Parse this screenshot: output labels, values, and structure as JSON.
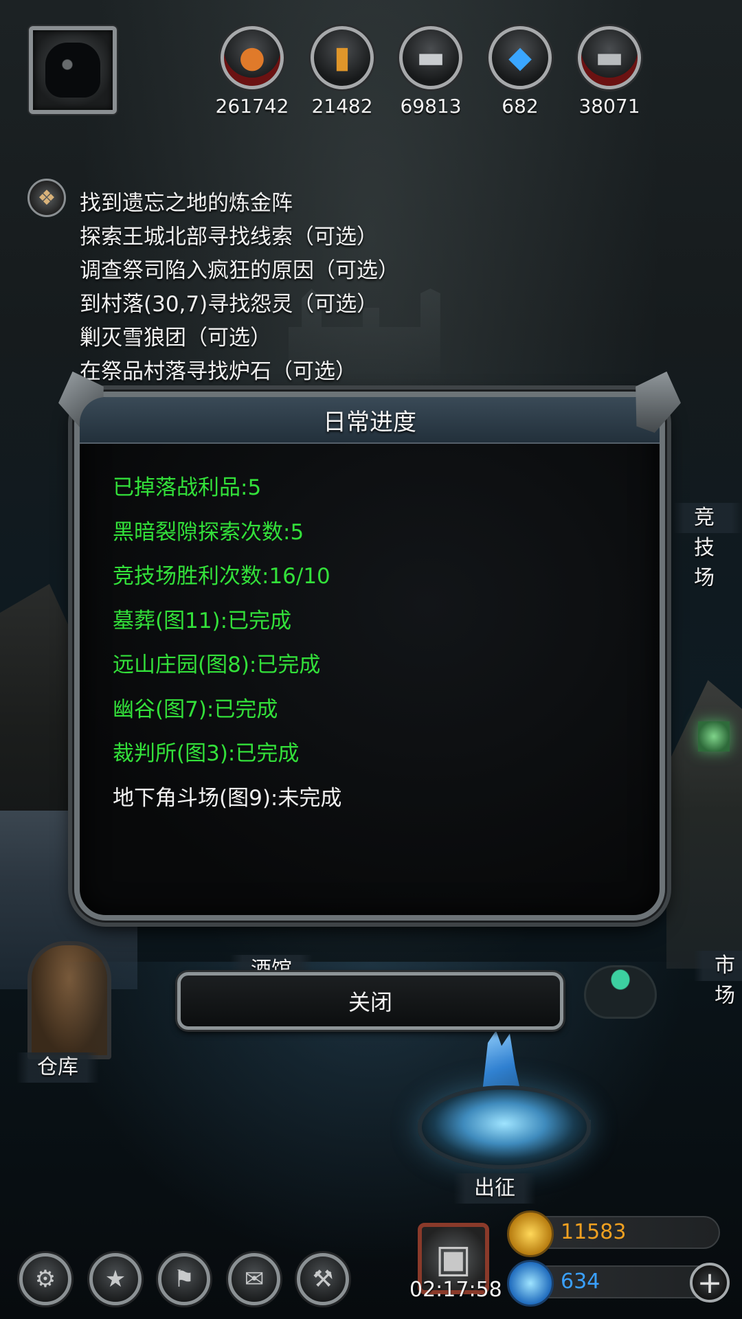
{
  "resources": [
    {
      "icon": "meat-icon",
      "value": "261742"
    },
    {
      "icon": "wood-icon",
      "value": "21482"
    },
    {
      "icon": "iron-icon",
      "value": "69813"
    },
    {
      "icon": "crystal-icon",
      "value": "682"
    },
    {
      "icon": "steel-icon",
      "value": "38071"
    }
  ],
  "quests": [
    "找到遗忘之地的炼金阵",
    "探索王城北部寻找线索（可选）",
    "调查祭司陷入疯狂的原因（可选）",
    "到村落(30,7)寻找怨灵（可选）",
    "剿灭雪狼团（可选）",
    "在祭品村落寻找炉石（可选）"
  ],
  "dialog": {
    "title": "日常进度",
    "items": [
      {
        "text": "已掉落战利品:5",
        "status": "done"
      },
      {
        "text": "黑暗裂隙探索次数:5",
        "status": "done"
      },
      {
        "text": "竞技场胜利次数:16/10",
        "status": "done"
      },
      {
        "text": "墓葬(图11):已完成",
        "status": "done"
      },
      {
        "text": "远山庄园(图8):已完成",
        "status": "done"
      },
      {
        "text": "幽谷(图7):已完成",
        "status": "done"
      },
      {
        "text": "裁判所(图3):已完成",
        "status": "done"
      },
      {
        "text": "地下角斗场(图9):未完成",
        "status": "pending"
      }
    ],
    "close_label": "关闭"
  },
  "map_labels": {
    "arena": "竞技场",
    "tavern": "酒馆",
    "market": "市场",
    "warehouse": "仓库",
    "expedition": "出征"
  },
  "bottom": {
    "timer": "02:17:58",
    "gold": "11583",
    "gems": "634"
  },
  "colors": {
    "done": "#33e03a",
    "pending": "#f2f2f2",
    "gold_text": "#f0a020",
    "gem_text": "#3aa0ff"
  }
}
